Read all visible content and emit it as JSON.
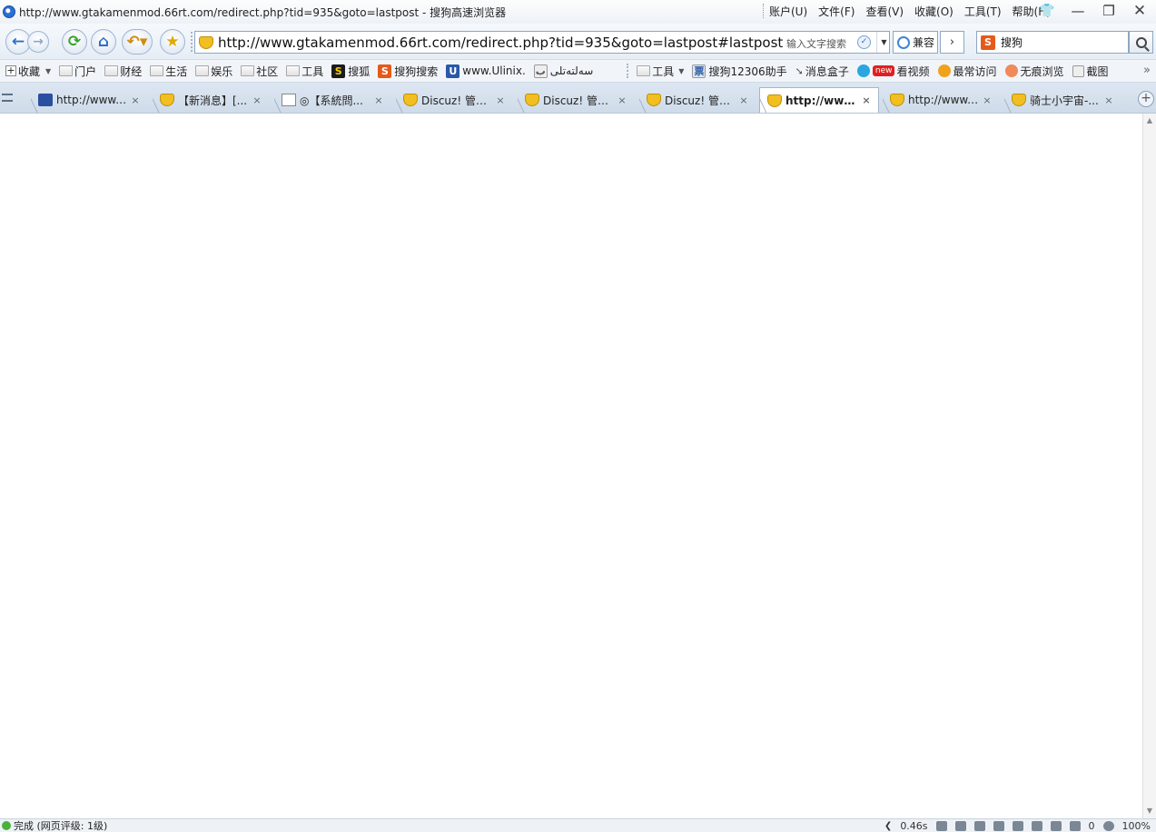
{
  "titlebar": {
    "title": "http://www.gtakamenmod.66rt.com/redirect.php?tid=935&goto=lastpost - 搜狗高速浏览器",
    "menus": [
      "账户(U)",
      "文件(F)",
      "查看(V)",
      "收藏(O)",
      "工具(T)",
      "帮助(H)"
    ],
    "minimize": "—",
    "restore": "❐",
    "close": "✕"
  },
  "navbar": {
    "back": "←",
    "forward": "→",
    "refresh": "⟳",
    "home": "⌂",
    "undo": "↶▾",
    "favorite": "★",
    "url": "http://www.gtakamenmod.66rt.com/redirect.php?tid=935&goto=lastpost#lastpost",
    "address_hint": "输入文字搜索",
    "compat_label": "兼容",
    "go": "›",
    "search_engine_icon": "S",
    "search_text": "搜狗"
  },
  "bookmarks": {
    "add": "收藏",
    "items": [
      {
        "label": "门户",
        "icon": "folder"
      },
      {
        "label": "财经",
        "icon": "folder"
      },
      {
        "label": "生活",
        "icon": "folder"
      },
      {
        "label": "娱乐",
        "icon": "folder"
      },
      {
        "label": "社区",
        "icon": "folder"
      },
      {
        "label": "工具",
        "icon": "folder"
      },
      {
        "label": "搜狐",
        "icon": "S"
      },
      {
        "label": "搜狗搜索",
        "icon": "S"
      },
      {
        "label": "www.Ulinix.",
        "icon": "U"
      },
      {
        "label": "سەلتەتلى",
        "icon": "page"
      }
    ],
    "right_items": [
      {
        "label": "工具",
        "icon": "folder"
      },
      {
        "label": "搜狗12306助手",
        "icon": "ticket"
      },
      {
        "label": "消息盒子",
        "icon": "arrow"
      },
      {
        "label": "看视频",
        "badge": "new"
      },
      {
        "label": "最常访问",
        "icon": "circle"
      },
      {
        "label": "无痕浏览",
        "icon": "circle"
      },
      {
        "label": "截图",
        "icon": "crop"
      }
    ],
    "more": "»"
  },
  "tabs": [
    {
      "label": "http://www.b...",
      "icon": "paw",
      "active": false
    },
    {
      "label": "【新消息】[...",
      "icon": "shield",
      "active": false
    },
    {
      "label": "◎【系統問...",
      "icon": "page",
      "active": false
    },
    {
      "label": "Discuz! 管理...",
      "icon": "shield",
      "active": false
    },
    {
      "label": "Discuz! 管理...",
      "icon": "shield",
      "active": false
    },
    {
      "label": "Discuz! 管理...",
      "icon": "shield",
      "active": false
    },
    {
      "label": "http://www....",
      "icon": "shield",
      "active": true
    },
    {
      "label": "http://www.g...",
      "icon": "shield",
      "active": false
    },
    {
      "label": "骑士小宇宙-...",
      "icon": "shield",
      "active": false
    }
  ],
  "tab_close": "×",
  "new_tab": "+",
  "statusbar": {
    "text": "完成 (网页评级: 1级)",
    "load_time": "0.46s",
    "count": "0",
    "zoom": "100%"
  }
}
